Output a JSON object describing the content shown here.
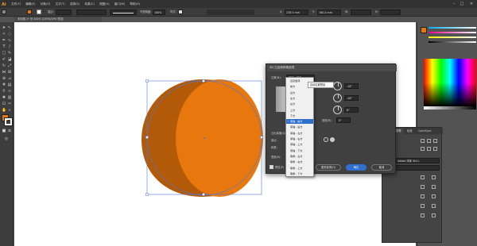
{
  "app": {
    "logo": "Ai",
    "menus": [
      "文件(F)",
      "编辑(E)",
      "对象(O)",
      "文字(T)",
      "选择(S)",
      "效果(C)",
      "视图(V)",
      "窗口(W)",
      "帮助(H)"
    ],
    "window_controls": [
      "–",
      "□",
      "×"
    ]
  },
  "control_bar": {
    "label_fill_color": "#e8780d",
    "stroke_label": "描边：",
    "stroke_value": "",
    "opacity_label": "不透明度：",
    "opacity_value": "100%",
    "style_label": "样式：",
    "x_value": "228.5 mm",
    "y_value": "160.4 mm",
    "w_value": "",
    "h_value": ""
  },
  "document": {
    "tab_label": "未标题-1* @ 400% (CMYK/GPU 预览)"
  },
  "toolbar": {
    "fill_color": "#e8780d",
    "stroke_color": "#ffffff"
  },
  "artwork": {
    "face_color": "#e8780d",
    "side_color": "#b35a08"
  },
  "dialog": {
    "title": "3D 凸出和斜角选项",
    "position_label": "位置(N):",
    "position_value": "离轴 - 前方",
    "x_deg": "-18°",
    "y_deg": "-26°",
    "z_deg": "8°",
    "perspective_label": "透视(R):",
    "perspective_value": "0°",
    "extrude_depth_label": "凸出厚度(D):",
    "cap_label": "端点：",
    "bevel_label": "斜角：",
    "height_label": "高度(H):",
    "surface_label": "表面(S):",
    "preview_label": "预览(P)",
    "map_button": "贴图(M)...",
    "more_options_button": "更多选项(O)",
    "ok_button": "确定",
    "cancel_button": "取消"
  },
  "tooltip": {
    "text": "自动位置预设"
  },
  "popup": {
    "items": [
      {
        "label": "自定旋转",
        "selected": false
      },
      {
        "label": "前方",
        "selected": false
      },
      {
        "label": "后方",
        "selected": false
      },
      {
        "label": "左方",
        "selected": false
      },
      {
        "label": "右方",
        "selected": false
      },
      {
        "label": "上方",
        "selected": false
      },
      {
        "label": "下方",
        "selected": false
      },
      {
        "label": "离轴 - 前方",
        "selected": true
      },
      {
        "label": "离轴 - 后方",
        "selected": false
      },
      {
        "label": "离轴 - 左方",
        "selected": false
      },
      {
        "label": "离轴 - 右方",
        "selected": false
      },
      {
        "label": "离轴 - 上方",
        "selected": false
      },
      {
        "label": "离轴 - 下方",
        "selected": false
      },
      {
        "label": "等角 - 左方",
        "selected": false
      },
      {
        "label": "等角 - 右方",
        "selected": false
      },
      {
        "label": "等角 - 上方",
        "selected": false
      },
      {
        "label": "等角 - 下方",
        "selected": false
      }
    ]
  },
  "char_panel": {
    "tab1": "字符",
    "tab2": "段落",
    "tab3": "OpenType",
    "font_value": "Adobe 宋体 Std L",
    "style_value": ""
  }
}
